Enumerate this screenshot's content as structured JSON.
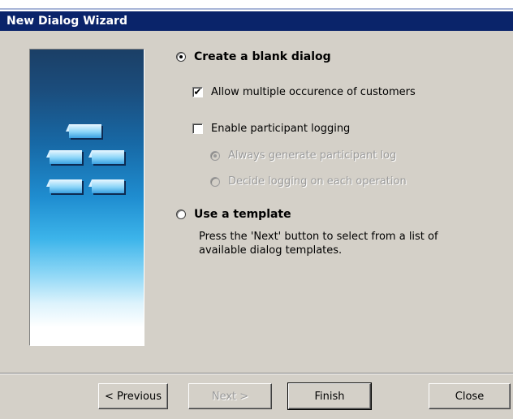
{
  "window": {
    "title": "New Dialog Wizard"
  },
  "options": {
    "create_blank": {
      "label": "Create a blank dialog",
      "selected": true
    },
    "allow_multiple": {
      "label": "Allow multiple occurence of customers",
      "checked": true
    },
    "enable_logging": {
      "label": "Enable participant logging",
      "checked": false
    },
    "always_generate": {
      "label": "Always generate participant log",
      "selected": true,
      "enabled": false
    },
    "decide_logging": {
      "label": "Decide logging on each operation",
      "selected": false,
      "enabled": false
    },
    "use_template": {
      "label": "Use a template",
      "selected": false,
      "description_line1": "Press the 'Next' button to select from a list of",
      "description_line2": "available dialog templates."
    }
  },
  "buttons": {
    "previous": "< Previous",
    "next": "Next >",
    "finish": "Finish",
    "close": "Close"
  },
  "colors": {
    "titlebar": "#0a246a",
    "dialog_bg": "#d4d0c8",
    "disabled_text": "#9a9a9a"
  },
  "icons": {
    "side_image": "stacked-blocks-banner"
  }
}
